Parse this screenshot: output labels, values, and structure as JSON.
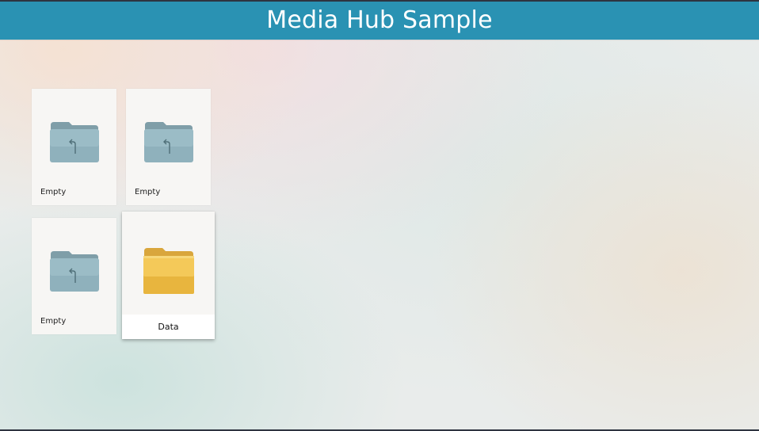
{
  "app": {
    "title": "Media Hub Sample"
  },
  "grid": {
    "tiles": [
      {
        "label": "Empty",
        "icon": "folder-up-icon",
        "state": "normal"
      },
      {
        "label": "Empty",
        "icon": "folder-up-icon",
        "state": "normal"
      },
      {
        "label": "Empty",
        "icon": "folder-up-icon",
        "state": "normal"
      },
      {
        "label": "Data",
        "icon": "folder-icon",
        "state": "focused"
      }
    ]
  },
  "colors": {
    "header": "#2a92b3",
    "folder_empty": "#8fb1bc",
    "folder_data": "#f0c24a"
  }
}
